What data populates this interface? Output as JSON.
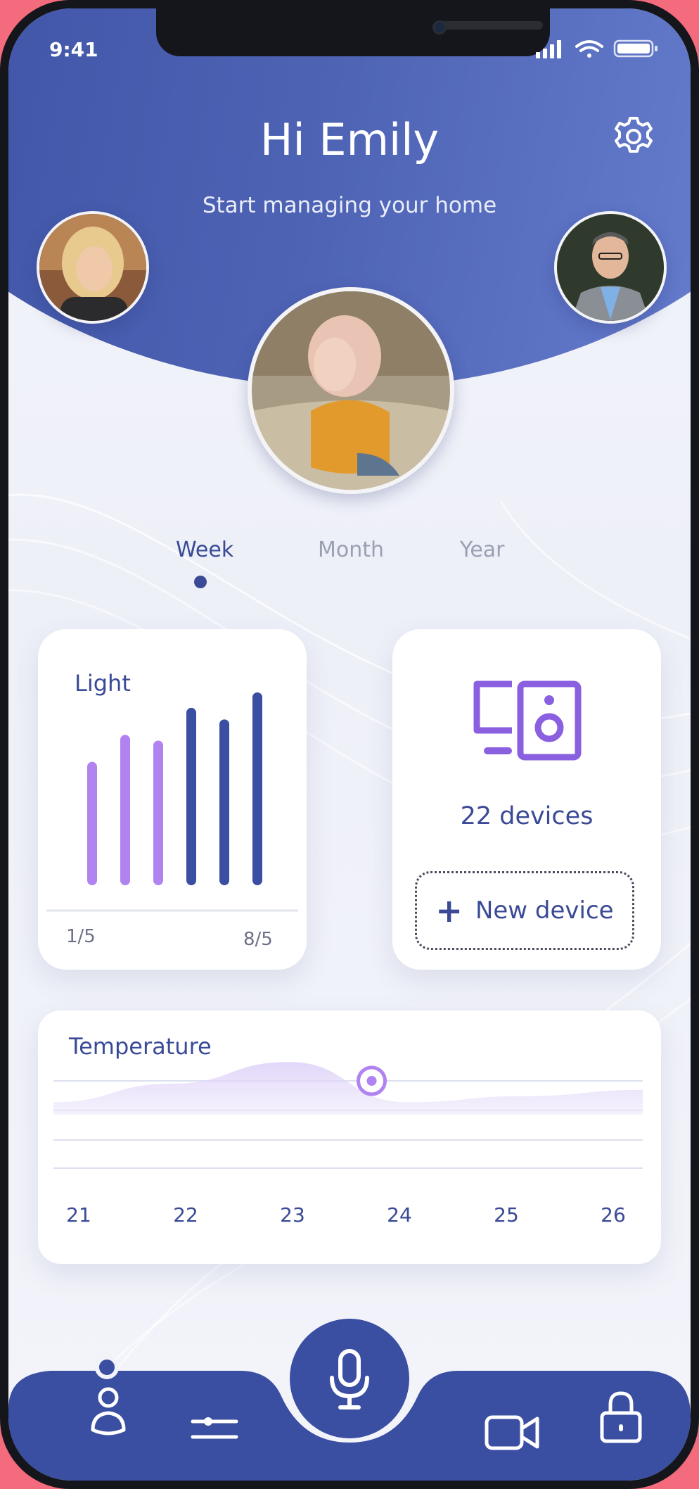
{
  "status_bar": {
    "time": "9:41"
  },
  "header": {
    "greeting": "Hi Emily",
    "subtitle": "Start managing your home"
  },
  "icons": {
    "settings": "gear-icon",
    "signal": "signal-icon",
    "wifi": "wifi-icon",
    "battery": "battery-icon",
    "devices": "monitor-speaker-icon",
    "add": "plus-icon",
    "microphone": "microphone-icon",
    "profile": "person-icon",
    "controls": "sliders-icon",
    "camera": "video-camera-icon",
    "lock": "lock-icon"
  },
  "period_tabs": [
    {
      "label": "Week",
      "active": true
    },
    {
      "label": "Month",
      "active": false
    },
    {
      "label": "Year",
      "active": false
    }
  ],
  "light_card": {
    "title": "Light",
    "start_label": "1/5",
    "end_label": "8/5"
  },
  "devices_card": {
    "count_label": "22 devices",
    "new_device_label": "New device"
  },
  "temperature_card": {
    "title": "Temperature",
    "x_labels": [
      "21",
      "22",
      "23",
      "24",
      "25",
      "26"
    ]
  },
  "colors": {
    "primary": "#3a4ea2",
    "accent_purple": "#b083f0",
    "text_primary": "#3a4a96",
    "muted": "#9aa0b4",
    "frame_background": "#f36b7c"
  },
  "chart_data": [
    {
      "type": "bar",
      "title": "Light",
      "categories": [
        "1/5",
        "",
        "",
        "",
        "",
        "8/5"
      ],
      "values": [
        0.64,
        0.78,
        0.75,
        0.92,
        0.86,
        1.0
      ],
      "colors": [
        "#b083f0",
        "#b083f0",
        "#b083f0",
        "#3a4ea2",
        "#3a4ea2",
        "#3a4ea2"
      ]
    },
    {
      "type": "area",
      "title": "Temperature",
      "x": [
        21,
        22,
        23,
        24,
        25,
        26
      ],
      "values": [
        0.2,
        0.5,
        0.85,
        0.2,
        0.3,
        0.4
      ],
      "highlight": {
        "x": 23.7
      }
    }
  ]
}
